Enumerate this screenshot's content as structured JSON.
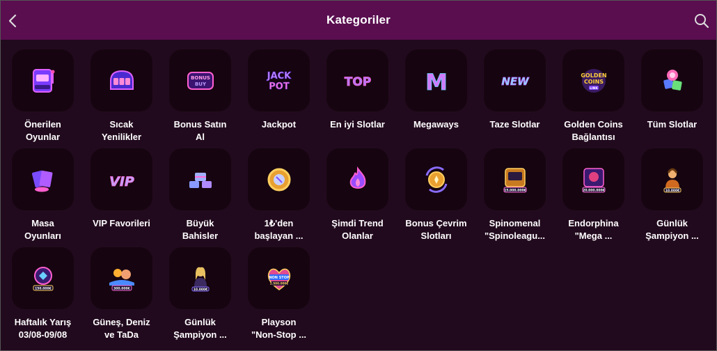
{
  "header": {
    "title": "Kategoriler"
  },
  "colors": {
    "header_bg": "#5a0e50",
    "page_bg": "#220a1e",
    "tile_bg": "#160510",
    "neon_pink": "#e040c0",
    "neon_purple": "#8a4cff"
  },
  "categories": [
    {
      "label": "Önerilen\nOyunlar",
      "icon": "slot-machine-icon"
    },
    {
      "label": "Sıcak\nYenilikler",
      "icon": "hot-slot-icon"
    },
    {
      "label": "Bonus Satın\nAl",
      "icon": "bonus-buy-icon",
      "icon_text": "BONUS BUY"
    },
    {
      "label": "Jackpot",
      "icon": "jackpot-icon",
      "icon_text": "JACK POT"
    },
    {
      "label": "En iyi Slotlar",
      "icon": "top-icon",
      "icon_text": "TOP"
    },
    {
      "label": "Megaways",
      "icon": "megaways-m-icon",
      "icon_text": "M"
    },
    {
      "label": "Taze Slotlar",
      "icon": "new-icon",
      "icon_text": "NEW"
    },
    {
      "label": "Golden Coins\nBağlantısı",
      "icon": "golden-coins-icon",
      "icon_text": "GOLDEN COINS LINK"
    },
    {
      "label": "Tüm Slotlar",
      "icon": "all-slots-icon"
    },
    {
      "label": "Masa\nOyunları",
      "icon": "table-games-icon"
    },
    {
      "label": "VIP Favorileri",
      "icon": "vip-icon",
      "icon_text": "VIP"
    },
    {
      "label": "Büyük\nBahisler",
      "icon": "big-bets-icon"
    },
    {
      "label": "1₺'den\nbaşlayan ...",
      "icon": "coin-icon"
    },
    {
      "label": "Şimdi Trend\nOlanlar",
      "icon": "flame-icon"
    },
    {
      "label": "Bonus Çevrim\nSlotları",
      "icon": "wagering-coin-icon"
    },
    {
      "label": "Spinomenal\n\"Spinoleagu...",
      "icon": "spinomenal-promo-icon",
      "icon_text": "15.000.000€"
    },
    {
      "label": "Endorphina\n\"Mega ...",
      "icon": "endorphina-promo-icon",
      "icon_text": "20.000.000€"
    },
    {
      "label": "Günlük\nŞampiyon ...",
      "icon": "daily-champion-icon",
      "icon_text": "10.000€"
    },
    {
      "label": "Haftalık Yarış\n03/08-09/08",
      "icon": "weekly-race-icon",
      "icon_text": "150.000€"
    },
    {
      "label": "Güneş, Deniz\nve TaDa",
      "icon": "sun-sea-tada-icon",
      "icon_text": "300.000€"
    },
    {
      "label": "Günlük\nŞampiyon ...",
      "icon": "daily-champion-2-icon",
      "icon_text": "10.000€"
    },
    {
      "label": "Playson\n\"Non-Stop ...",
      "icon": "playson-nonstop-icon",
      "icon_text": "NON STOP 2.500.000€"
    }
  ]
}
